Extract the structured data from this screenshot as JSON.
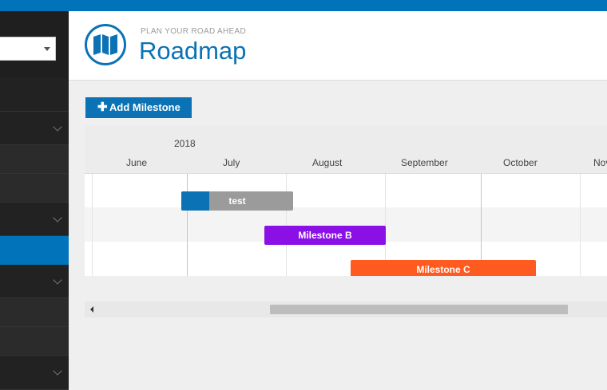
{
  "app": {
    "subtitle": "PLAN YOUR ROAD AHEAD",
    "title": "Roadmap",
    "accent_color": "#0a72b5"
  },
  "sidebar": {
    "select_value": "",
    "items": [
      {
        "label": "",
        "expandable": false,
        "active": false
      },
      {
        "label": "",
        "expandable": true,
        "active": false
      },
      {
        "label": "",
        "expandable": false,
        "active": false
      },
      {
        "label": "",
        "expandable": false,
        "active": false
      },
      {
        "label": "",
        "expandable": true,
        "active": false
      },
      {
        "label": "",
        "expandable": false,
        "active": true
      },
      {
        "label": "",
        "expandable": true,
        "active": false
      },
      {
        "label": "",
        "expandable": false,
        "active": false
      },
      {
        "label": "",
        "expandable": false,
        "active": false
      },
      {
        "label": "",
        "expandable": true,
        "active": false
      }
    ]
  },
  "toolbar": {
    "add_label": "Add Milestone",
    "add_icon": "plus-icon"
  },
  "gantt": {
    "year": "2018",
    "months": [
      "June",
      "July",
      "August",
      "September",
      "October",
      "Nov"
    ],
    "milestones": [
      {
        "name": "test",
        "color": "#9b9b9b",
        "progress_color": "#0a72b5",
        "progress": 0.25
      },
      {
        "name": "Milestone B",
        "color": "#8a10e6"
      },
      {
        "name": "Milestone C",
        "color": "#ff5a1f"
      }
    ]
  }
}
